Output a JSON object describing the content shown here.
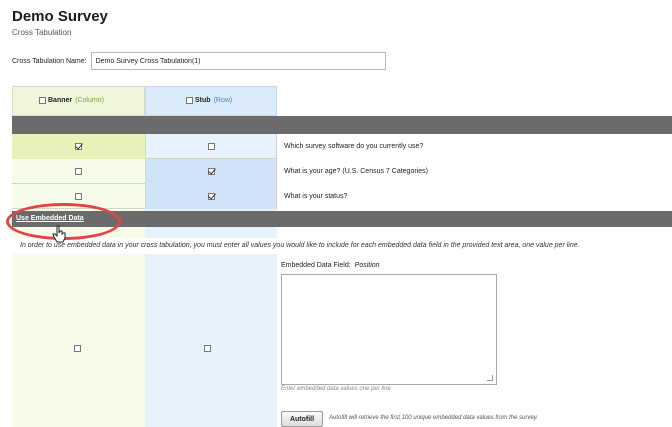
{
  "survey": {
    "title": "Demo Survey",
    "subtitle": "Cross Tabulation"
  },
  "crosstab": {
    "name_label": "Cross Tabulation Name:",
    "name_value": "Demo Survey Cross Tabulation(1)"
  },
  "headers": {
    "banner_label": "Banner",
    "banner_hint": "(Column)",
    "stub_label": "Stub",
    "stub_hint": "(Row)"
  },
  "questions": [
    {
      "text": "Which survey software do you currently use?",
      "banner_checked": true,
      "stub_checked": false
    },
    {
      "text": "What is your age? (U.S. Census 7 Categories)",
      "banner_checked": false,
      "stub_checked": true
    },
    {
      "text": "What is your status?",
      "banner_checked": false,
      "stub_checked": true
    }
  ],
  "embedded": {
    "link_label": "Use Embedded Data",
    "info_text": "In order to use embedded data in your cross tabulation, you must enter all values you would like to include for each embedded data field in the provided text area, one value per line.",
    "field_label": "Embedded Data Field:",
    "field_name": "Position",
    "textarea_hint": "Enter embedded data values one per line",
    "autofill_label": "Autofill",
    "autofill_desc": "Autofill will retrieve the first 100 unique embedded data values from the survey."
  },
  "colors": {
    "banner_bg": "#f7fbe9",
    "stub_bg": "#e7f2fd",
    "section_bar": "#6b6b6b",
    "highlight_ellipse": "#e04646"
  }
}
